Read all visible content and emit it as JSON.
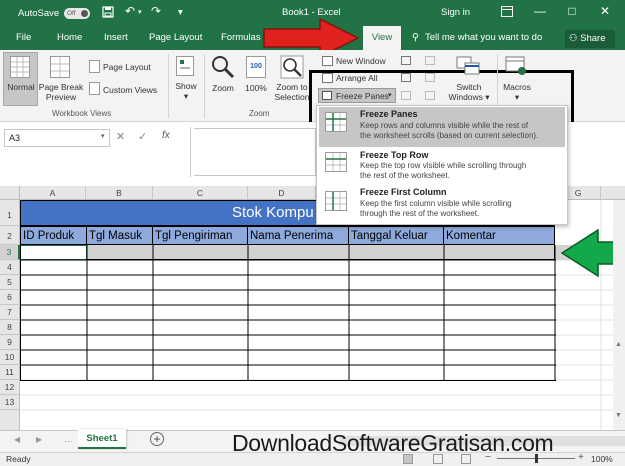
{
  "titlebar": {
    "autosave": "AutoSave",
    "autosave_state": "Off",
    "doc_title": "Book1 - Excel",
    "sign_in": "Sign in",
    "minimize": "—",
    "restore": "□",
    "close": "✕"
  },
  "tabs": {
    "file": "File",
    "home": "Home",
    "insert": "Insert",
    "page_layout": "Page Layout",
    "formulas": "Formulas",
    "view": "View",
    "tell_me": "Tell me what you want to do",
    "share": "Share"
  },
  "ribbon": {
    "normal": "Normal",
    "page_break_1": "Page Break",
    "page_break_2": "Preview",
    "page_layout": "Page Layout",
    "custom_views": "Custom Views",
    "show": "Show",
    "zoom": "Zoom",
    "zoom_100": "100%",
    "zoom_to_1": "Zoom to",
    "zoom_to_2": "Selection",
    "new_window": "New Window",
    "arrange_all": "Arrange All",
    "freeze_panes": "Freeze Panes",
    "switch_1": "Switch",
    "switch_2": "Windows",
    "macros": "Macros",
    "group_workbook_views": "Workbook Views",
    "group_zoom": "Zoom"
  },
  "dropdown": {
    "items": [
      {
        "title": "Freeze Panes",
        "desc1": "Keep rows and columns visible while the rest of",
        "desc2": "the worksheet scrolls (based on current selection)."
      },
      {
        "title": "Freeze Top Row",
        "desc1": "Keep the top row visible while scrolling through",
        "desc2": "the rest of the worksheet."
      },
      {
        "title": "Freeze First Column",
        "desc1": "Keep the first column visible while scrolling",
        "desc2": "through the rest of the worksheet."
      }
    ]
  },
  "formula_bar": {
    "name_box": "A3",
    "cancel": "✕",
    "enter": "✓",
    "fx": "fx"
  },
  "grid": {
    "columns": [
      "A",
      "B",
      "C",
      "D",
      "G"
    ],
    "rows": [
      "1",
      "2",
      "3",
      "4",
      "5",
      "6",
      "7",
      "8",
      "9",
      "10",
      "11",
      "12",
      "13"
    ],
    "title": "Stok Kompu",
    "headers": [
      "ID Produk",
      "Tgl Masuk",
      "Tgl Pengiriman",
      "Nama Penerima",
      "Tanggal Keluar",
      "Komentar"
    ]
  },
  "sheet": {
    "tab": "Sheet1",
    "add": "+"
  },
  "status": {
    "ready": "Ready",
    "zoom": "100%"
  },
  "watermark": "DownloadSoftwareGratisan.com",
  "colors": {
    "excel_green": "#217346",
    "header_blue": "#8ea9db",
    "title_blue": "#4472c4",
    "arrow_red": "#e0221f",
    "arrow_green": "#13a84a"
  }
}
